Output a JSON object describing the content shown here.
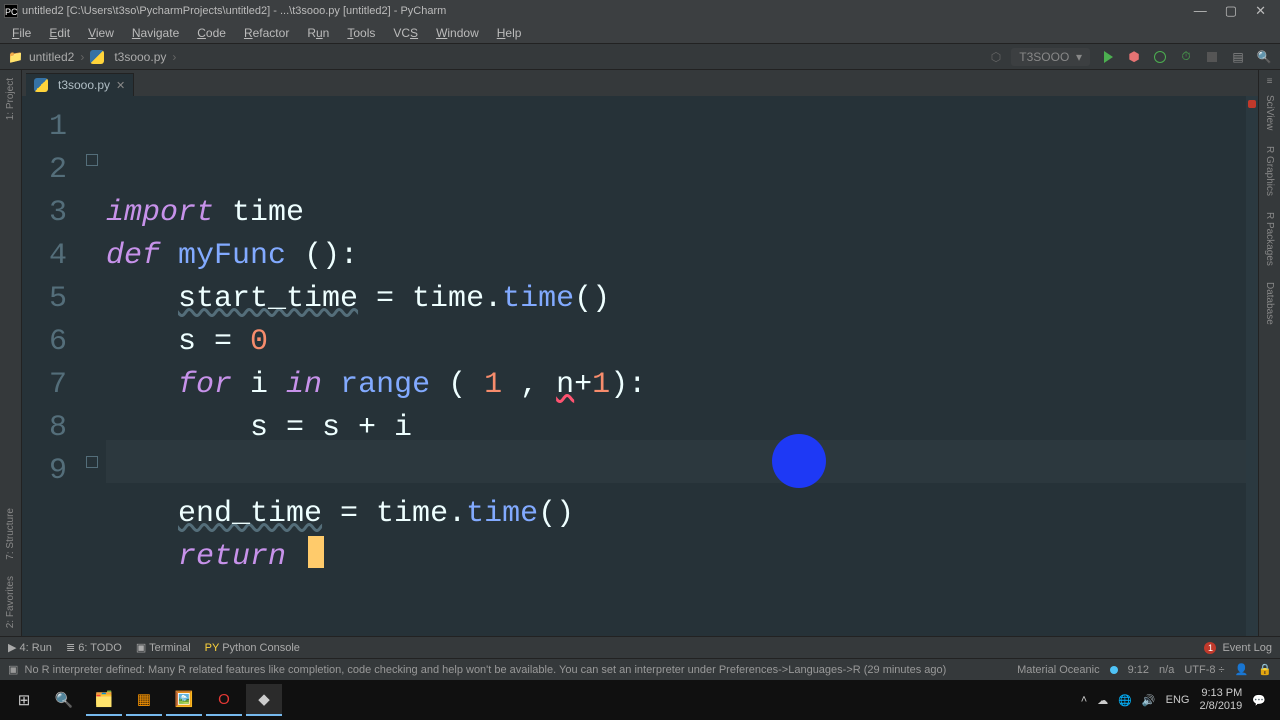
{
  "window_title": "untitled2 [C:\\Users\\t3so\\PycharmProjects\\untitled2] - ...\\t3sooo.py [untitled2] - PyCharm",
  "menus": [
    "File",
    "Edit",
    "View",
    "Navigate",
    "Code",
    "Refactor",
    "Run",
    "Tools",
    "VCS",
    "Window",
    "Help"
  ],
  "breadcrumbs": {
    "project": "untitled2",
    "file": "t3sooo.py"
  },
  "run_config": "T3SOOO",
  "tab_name": "t3sooo.py",
  "left_tools": [
    "1: Project",
    "7: Structure",
    "2: Favorites"
  ],
  "right_tools": [
    "SciView",
    "R Graphics",
    "R Packages",
    "Database"
  ],
  "bottom_tools": [
    "4: Run",
    "6: TODO",
    "Terminal",
    "Python Console"
  ],
  "event_log": "Event Log",
  "info_message": "No R interpreter defined: Many R related features like completion, code checking and help won't be available. You can set an interpreter under Preferences->Languages->R (29 minutes ago)",
  "status": {
    "theme": "Material Oceanic",
    "pos": "9:12",
    "sep": "n/a",
    "enc": "UTF-8"
  },
  "taskbar_lang": "ENG",
  "clock_time": "9:13 PM",
  "clock_date": "2/8/2019",
  "code_lines": [
    "import time",
    "def myFunc ():",
    "    start_time = time.time()",
    "    s = 0",
    "    for i in range ( 1 , n+1):",
    "        s = s + i",
    "",
    "    end_time = time.time()",
    "    return "
  ]
}
